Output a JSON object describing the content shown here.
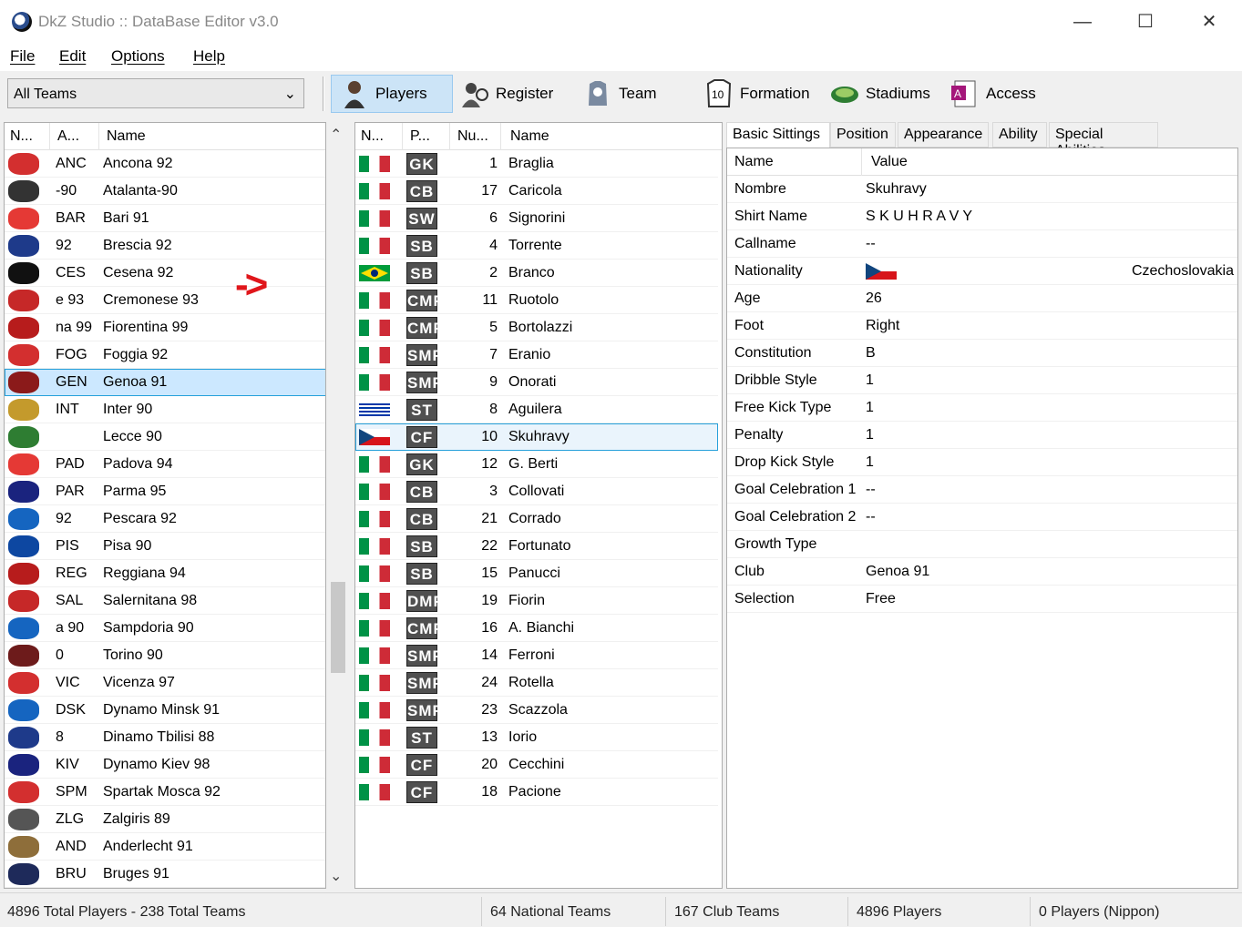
{
  "window": {
    "title": "DkZ Studio :: DataBase Editor v3.0",
    "min": "—",
    "max": "☐",
    "close": "✕"
  },
  "menu": [
    "File",
    "Edit",
    "Options",
    "Help"
  ],
  "toolbar": {
    "team_filter": "All Teams",
    "buttons": [
      "Players",
      "Register",
      "Team",
      "Formation",
      "Stadiums",
      "Access"
    ]
  },
  "teams": {
    "headers": [
      "N...",
      "A...",
      "Name"
    ],
    "rows": [
      {
        "abbr": "ANC",
        "name": "Ancona 92",
        "crest": "#d32f2f"
      },
      {
        "abbr": "-90",
        "name": "Atalanta-90",
        "crest": "#333333"
      },
      {
        "abbr": "BAR",
        "name": "Bari 91",
        "crest": "#e53935"
      },
      {
        "abbr": "92",
        "name": "Brescia 92",
        "crest": "#1e3a8a"
      },
      {
        "abbr": "CES",
        "name": "Cesena 92",
        "crest": "#111111"
      },
      {
        "abbr": "e 93",
        "name": "Cremonese 93",
        "crest": "#c62828"
      },
      {
        "abbr": "na 99",
        "name": "Fiorentina 99",
        "crest": "#b71c1c"
      },
      {
        "abbr": "FOG",
        "name": "Foggia 92",
        "crest": "#d32f2f"
      },
      {
        "abbr": "GEN",
        "name": "Genoa 91",
        "crest": "#8b1a1a"
      },
      {
        "abbr": "INT",
        "name": "Inter 90",
        "crest": "#c49a2c"
      },
      {
        "abbr": "",
        "name": "Lecce 90",
        "crest": "#2e7d32"
      },
      {
        "abbr": "PAD",
        "name": "Padova 94",
        "crest": "#e53935"
      },
      {
        "abbr": "PAR",
        "name": "Parma 95",
        "crest": "#1a237e"
      },
      {
        "abbr": "92",
        "name": "Pescara 92",
        "crest": "#1565c0"
      },
      {
        "abbr": "PIS",
        "name": "Pisa 90",
        "crest": "#0d47a1"
      },
      {
        "abbr": "REG",
        "name": "Reggiana 94",
        "crest": "#b71c1c"
      },
      {
        "abbr": "SAL",
        "name": "Salernitana 98",
        "crest": "#c62828"
      },
      {
        "abbr": "a 90",
        "name": "Sampdoria 90",
        "crest": "#1565c0"
      },
      {
        "abbr": "0",
        "name": "Torino 90",
        "crest": "#6d1b1b"
      },
      {
        "abbr": "VIC",
        "name": "Vicenza 97",
        "crest": "#d32f2f"
      },
      {
        "abbr": "DSK",
        "name": "Dynamo Minsk 91",
        "crest": "#1565c0"
      },
      {
        "abbr": "8",
        "name": "Dinamo Tbilisi 88",
        "crest": "#1e3a8a"
      },
      {
        "abbr": "KIV",
        "name": "Dynamo Kiev 98",
        "crest": "#1a237e"
      },
      {
        "abbr": "SPM",
        "name": "Spartak Mosca 92",
        "crest": "#d32f2f"
      },
      {
        "abbr": "ZLG",
        "name": "Zalgiris 89",
        "crest": "#555555"
      },
      {
        "abbr": "AND",
        "name": "Anderlecht 91",
        "crest": "#8e6e3a"
      },
      {
        "abbr": "BRU",
        "name": "Bruges 91",
        "crest": "#1e2a5a"
      }
    ]
  },
  "players": {
    "headers": [
      "N...",
      "P...",
      "Nu...",
      "Name"
    ],
    "rows": [
      {
        "flag": "it",
        "pos": "GK",
        "num": "1",
        "name": "Braglia"
      },
      {
        "flag": "it",
        "pos": "CB",
        "num": "17",
        "name": "Caricola"
      },
      {
        "flag": "it",
        "pos": "SW",
        "num": "6",
        "name": "Signorini"
      },
      {
        "flag": "it",
        "pos": "SB",
        "num": "4",
        "name": "Torrente"
      },
      {
        "flag": "br",
        "pos": "SB",
        "num": "2",
        "name": "Branco"
      },
      {
        "flag": "it",
        "pos": "CMF",
        "num": "11",
        "name": "Ruotolo"
      },
      {
        "flag": "it",
        "pos": "CMF",
        "num": "5",
        "name": "Bortolazzi"
      },
      {
        "flag": "it",
        "pos": "SMF",
        "num": "7",
        "name": "Eranio"
      },
      {
        "flag": "it",
        "pos": "SMF",
        "num": "9",
        "name": "Onorati"
      },
      {
        "flag": "uy",
        "pos": "ST",
        "num": "8",
        "name": "Aguilera"
      },
      {
        "flag": "cz",
        "pos": "CF",
        "num": "10",
        "name": "Skuhravy"
      },
      {
        "flag": "it",
        "pos": "GK",
        "num": "12",
        "name": "G. Berti"
      },
      {
        "flag": "it",
        "pos": "CB",
        "num": "3",
        "name": "Collovati"
      },
      {
        "flag": "it",
        "pos": "CB",
        "num": "21",
        "name": "Corrado"
      },
      {
        "flag": "it",
        "pos": "SB",
        "num": "22",
        "name": "Fortunato"
      },
      {
        "flag": "it",
        "pos": "SB",
        "num": "15",
        "name": "Panucci"
      },
      {
        "flag": "it",
        "pos": "DMF",
        "num": "19",
        "name": "Fiorin"
      },
      {
        "flag": "it",
        "pos": "CMF",
        "num": "16",
        "name": "A. Bianchi"
      },
      {
        "flag": "it",
        "pos": "SMF",
        "num": "14",
        "name": "Ferroni"
      },
      {
        "flag": "it",
        "pos": "SMF",
        "num": "24",
        "name": "Rotella"
      },
      {
        "flag": "it",
        "pos": "SMF",
        "num": "23",
        "name": "Scazzola"
      },
      {
        "flag": "it",
        "pos": "ST",
        "num": "13",
        "name": "Iorio"
      },
      {
        "flag": "it",
        "pos": "CF",
        "num": "20",
        "name": "Cecchini"
      },
      {
        "flag": "it",
        "pos": "CF",
        "num": "18",
        "name": "Pacione"
      }
    ]
  },
  "details": {
    "tabs": [
      "Basic Sittings",
      "Position",
      "Appearance",
      "Ability",
      "Special Abilities"
    ],
    "headers": [
      "Name",
      "Value"
    ],
    "rows": [
      {
        "k": "Nombre",
        "v": "Skuhravy"
      },
      {
        "k": "Shirt Name",
        "v": "S K U H R A V Y"
      },
      {
        "k": "Callname",
        "v": "--"
      },
      {
        "k": "Nationality",
        "v": "Czechoslovakia"
      },
      {
        "k": "Age",
        "v": "26"
      },
      {
        "k": "Foot",
        "v": "Right"
      },
      {
        "k": "Constitution",
        "v": "B"
      },
      {
        "k": "Dribble Style",
        "v": "1"
      },
      {
        "k": "Free Kick Type",
        "v": "1"
      },
      {
        "k": "Penalty",
        "v": "1"
      },
      {
        "k": "Drop Kick Style",
        "v": "1"
      },
      {
        "k": "Goal Celebration 1",
        "v": "--"
      },
      {
        "k": "Goal Celebration 2",
        "v": "--"
      },
      {
        "k": "Growth Type",
        "v": ""
      },
      {
        "k": "Club",
        "v": "Genoa 91"
      },
      {
        "k": "Selection",
        "v": "Free"
      }
    ]
  },
  "annotation": "->",
  "status": [
    "4896 Total Players  -  238 Total Teams",
    "64 National Teams",
    "167 Club Teams",
    "4896 Players",
    "0 Players (Nippon)"
  ]
}
